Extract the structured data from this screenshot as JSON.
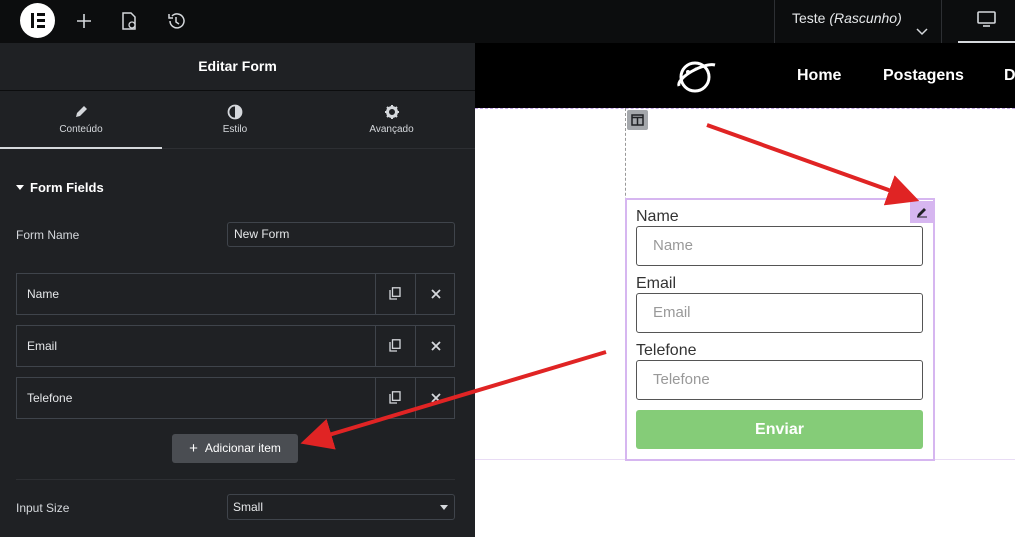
{
  "topbar": {
    "document_name": "Teste",
    "document_status": "(Rascunho)"
  },
  "panel": {
    "title": "Editar Form",
    "tabs": [
      {
        "label": "Conteúdo",
        "icon": "pencil-icon",
        "active": true
      },
      {
        "label": "Estilo",
        "icon": "half-circle-icon",
        "active": false
      },
      {
        "label": "Avançado",
        "icon": "gear-icon",
        "active": false
      }
    ],
    "section_title": "Form Fields",
    "form_name_label": "Form Name",
    "form_name_value": "New Form",
    "fields": [
      {
        "label": "Name"
      },
      {
        "label": "Email"
      },
      {
        "label": "Telefone"
      }
    ],
    "add_item_label": "Adicionar item",
    "input_size_label": "Input Size",
    "input_size_value": "Small"
  },
  "site": {
    "nav": [
      "Home",
      "Postagens",
      "D"
    ]
  },
  "form_preview": {
    "fields": [
      {
        "label": "Name",
        "placeholder": "Name"
      },
      {
        "label": "Email",
        "placeholder": "Email"
      },
      {
        "label": "Telefone",
        "placeholder": "Telefone"
      }
    ],
    "submit_label": "Enviar"
  },
  "colors": {
    "panel_bg": "#1f2124",
    "submit_bg": "#85cc78",
    "selection": "#d6b6f0",
    "arrow": "#e02424"
  }
}
